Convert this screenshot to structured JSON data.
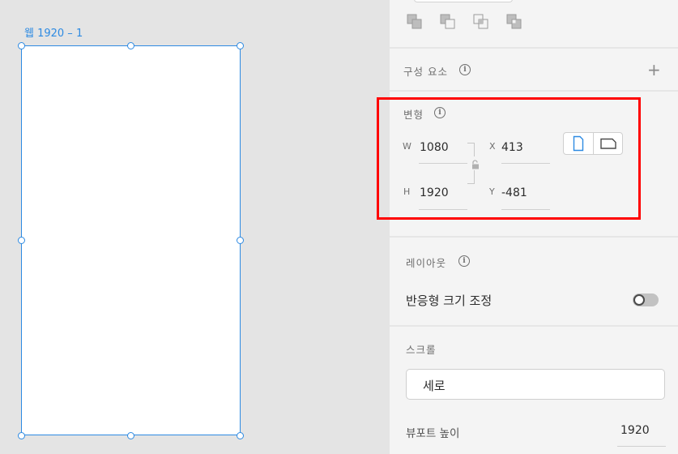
{
  "canvas": {
    "artboard_title": "웹 1920 – 1",
    "selection_color": "#2d8ae2"
  },
  "inspector": {
    "boolean_buttons": [
      "add-icon",
      "subtract-icon",
      "intersect-icon",
      "exclude-icon"
    ],
    "components": {
      "label": "구성 요소",
      "add_icon": "+"
    },
    "transform": {
      "label": "변형",
      "w_label": "W",
      "w_value": "1080",
      "h_label": "H",
      "h_value": "1920",
      "x_label": "X",
      "x_value": "413",
      "y_label": "Y",
      "y_value": "-481",
      "orientation": [
        "portrait-icon",
        "landscape-icon"
      ],
      "highlight_color": "#ff0000"
    },
    "layout": {
      "label": "레이아웃",
      "responsive_resize_label": "반응형 크기 조정",
      "responsive_resize_on": false
    },
    "scroll": {
      "label": "스크롤",
      "selected": "세로"
    },
    "viewport_height": {
      "label": "뷰포트 높이",
      "value": "1920"
    }
  }
}
